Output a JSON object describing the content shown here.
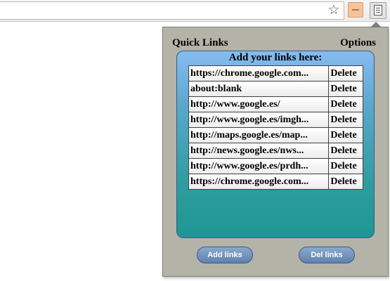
{
  "toolbar": {
    "star_icon": "star-icon",
    "extension_icon": "extension-icon",
    "menu_icon": "menu-icon"
  },
  "popup": {
    "title": "Quick Links",
    "options_label": "Options",
    "panel_heading": "Add your links here:",
    "delete_label": "Delete",
    "links": [
      "https://chrome.google.com...",
      "about:blank",
      "http://www.google.es/",
      "http://www.google.es/imgh...",
      "http://maps.google.es/map...",
      "http://news.google.es/nws...",
      "http://www.google.es/prdh...",
      "https://chrome.google.com..."
    ],
    "add_button": "Add links",
    "del_button": "Del links"
  }
}
